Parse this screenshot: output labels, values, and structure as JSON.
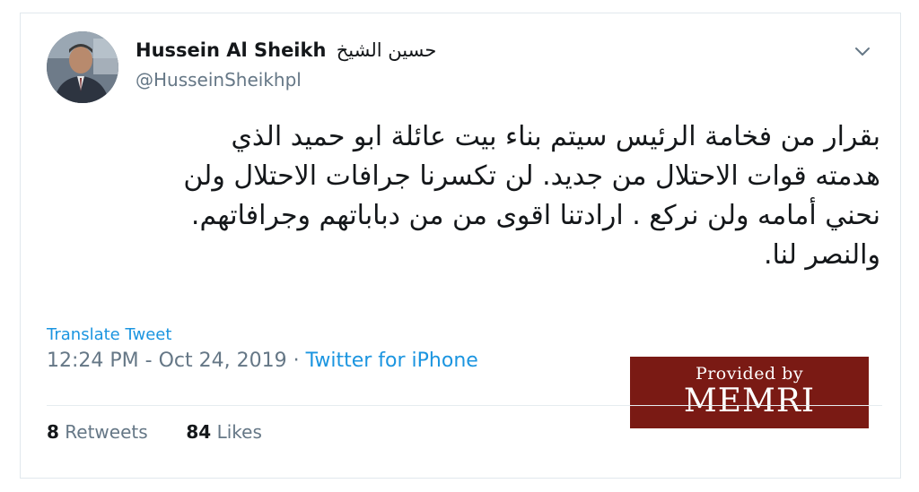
{
  "tweet": {
    "display_name": "Hussein Al Sheikh",
    "display_name_arabic": "حسين الشيخ",
    "handle": "@HusseinSheikhpl",
    "text_lines": [
      "بقرار من فخامة الرئيس سيتم بناء بيت عائلة ابو حميد الذي",
      "هدمته قوات الاحتلال من جديد. لن تكسرنا جرافات الاحتلال ولن",
      "نحني أمامه ولن نركع . ارادتنا اقوى من من دباباتهم وجرافاتهم.",
      "والنصر لنا."
    ],
    "translate_label": "Translate Tweet",
    "time": "12:24 PM",
    "separator_1": " - ",
    "date": "Oct 24, 2019",
    "separator_2": " · ",
    "source": "Twitter for iPhone",
    "retweets_count": "8",
    "retweets_label": "Retweets",
    "likes_count": "84",
    "likes_label": "Likes"
  },
  "watermark": {
    "provided_by": "Provided by",
    "brand": "MEMRI",
    "color": "#7a1a14"
  },
  "icons": {
    "menu": "chevron-down-icon",
    "avatar": "profile-photo"
  },
  "colors": {
    "link": "#1b95e0",
    "secondary_text": "#657786",
    "primary_text": "#14171a"
  }
}
